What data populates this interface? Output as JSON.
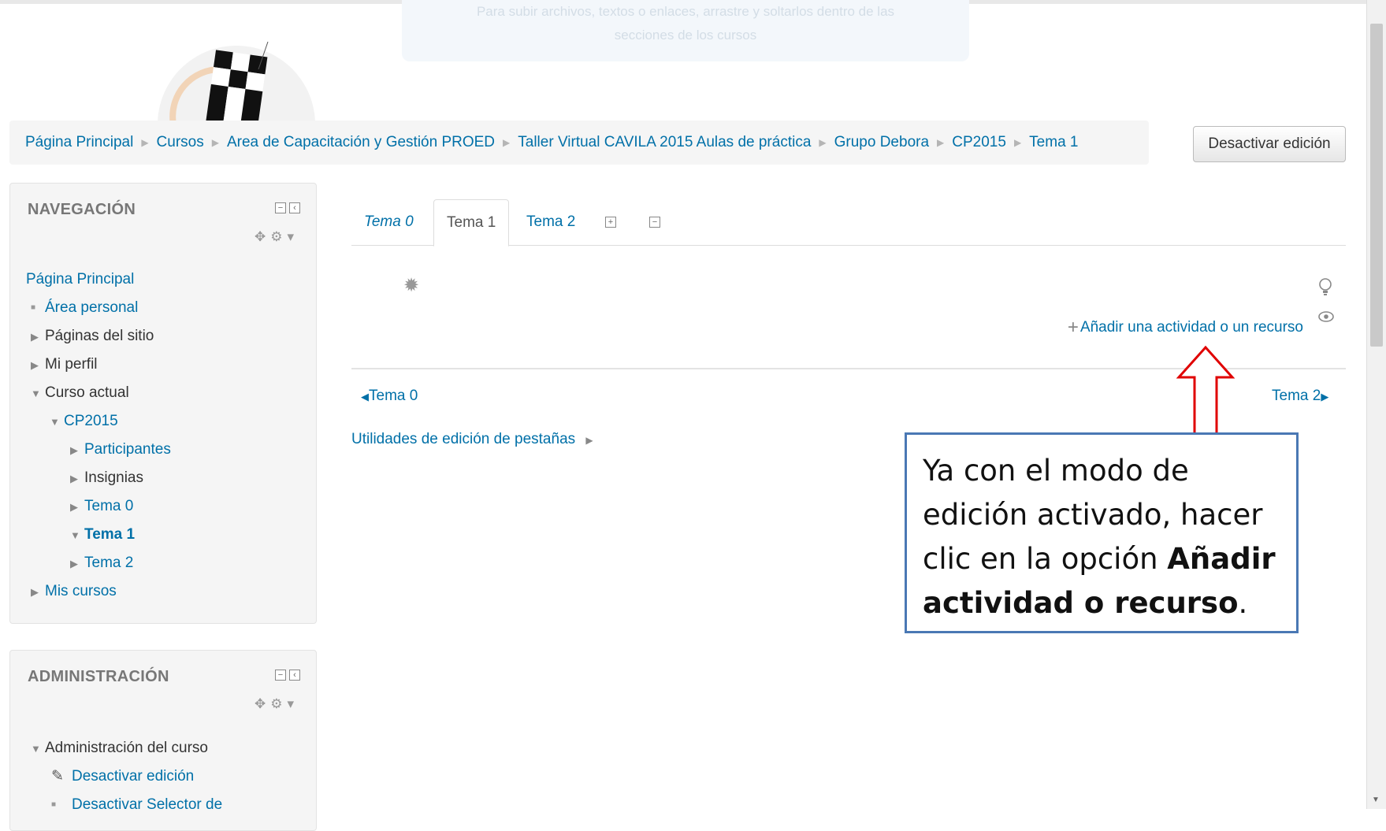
{
  "tooltip": {
    "line1": "Para subir archivos, textos o enlaces, arrastre y soltarlos dentro de las",
    "line2": "secciones de los cursos"
  },
  "breadcrumb": [
    "Página Principal",
    "Cursos",
    "Area de Capacitación y Gestión PROED",
    "Taller Virtual CAVILA 2015 Aulas de práctica",
    "Grupo Debora",
    "CP2015",
    "Tema 1"
  ],
  "header": {
    "edit_button": "Desactivar edición"
  },
  "navigation": {
    "title": "NAVEGACIÓN",
    "items": {
      "home": "Página Principal",
      "personal": "Área personal",
      "site_pages": "Páginas del sitio",
      "profile": "Mi perfil",
      "current_course": "Curso actual",
      "course": "CP2015",
      "participants": "Participantes",
      "badges": "Insignias",
      "tema0": "Tema 0",
      "tema1": "Tema 1",
      "tema2": "Tema 2",
      "my_courses": "Mis cursos"
    }
  },
  "administration": {
    "title": "ADMINISTRACIÓN",
    "items": {
      "course_admin": "Administración del curso",
      "disable_edit": "Desactivar edición",
      "disable_selector": "Desactivar Selector de"
    }
  },
  "tabs": [
    "Tema 0",
    "Tema 1",
    "Tema 2"
  ],
  "section": {
    "add_activity": "Añadir una actividad o un recurso"
  },
  "pager": {
    "prev": "Tema 0",
    "next": "Tema 2"
  },
  "utilities": "Utilidades de edición de pestañas",
  "callout": {
    "text1": "Ya con el modo de edición activado, hacer clic en la opción ",
    "bold": "Añadir actividad o recurso",
    "text2": "."
  },
  "colors": {
    "link": "#0070a8",
    "callout_border": "#4a78b4",
    "arrow": "#e00000"
  },
  "icons": [
    "gear-icon",
    "move-icon",
    "lightbulb-icon",
    "eye-icon",
    "plus-icon",
    "pencil-icon"
  ]
}
